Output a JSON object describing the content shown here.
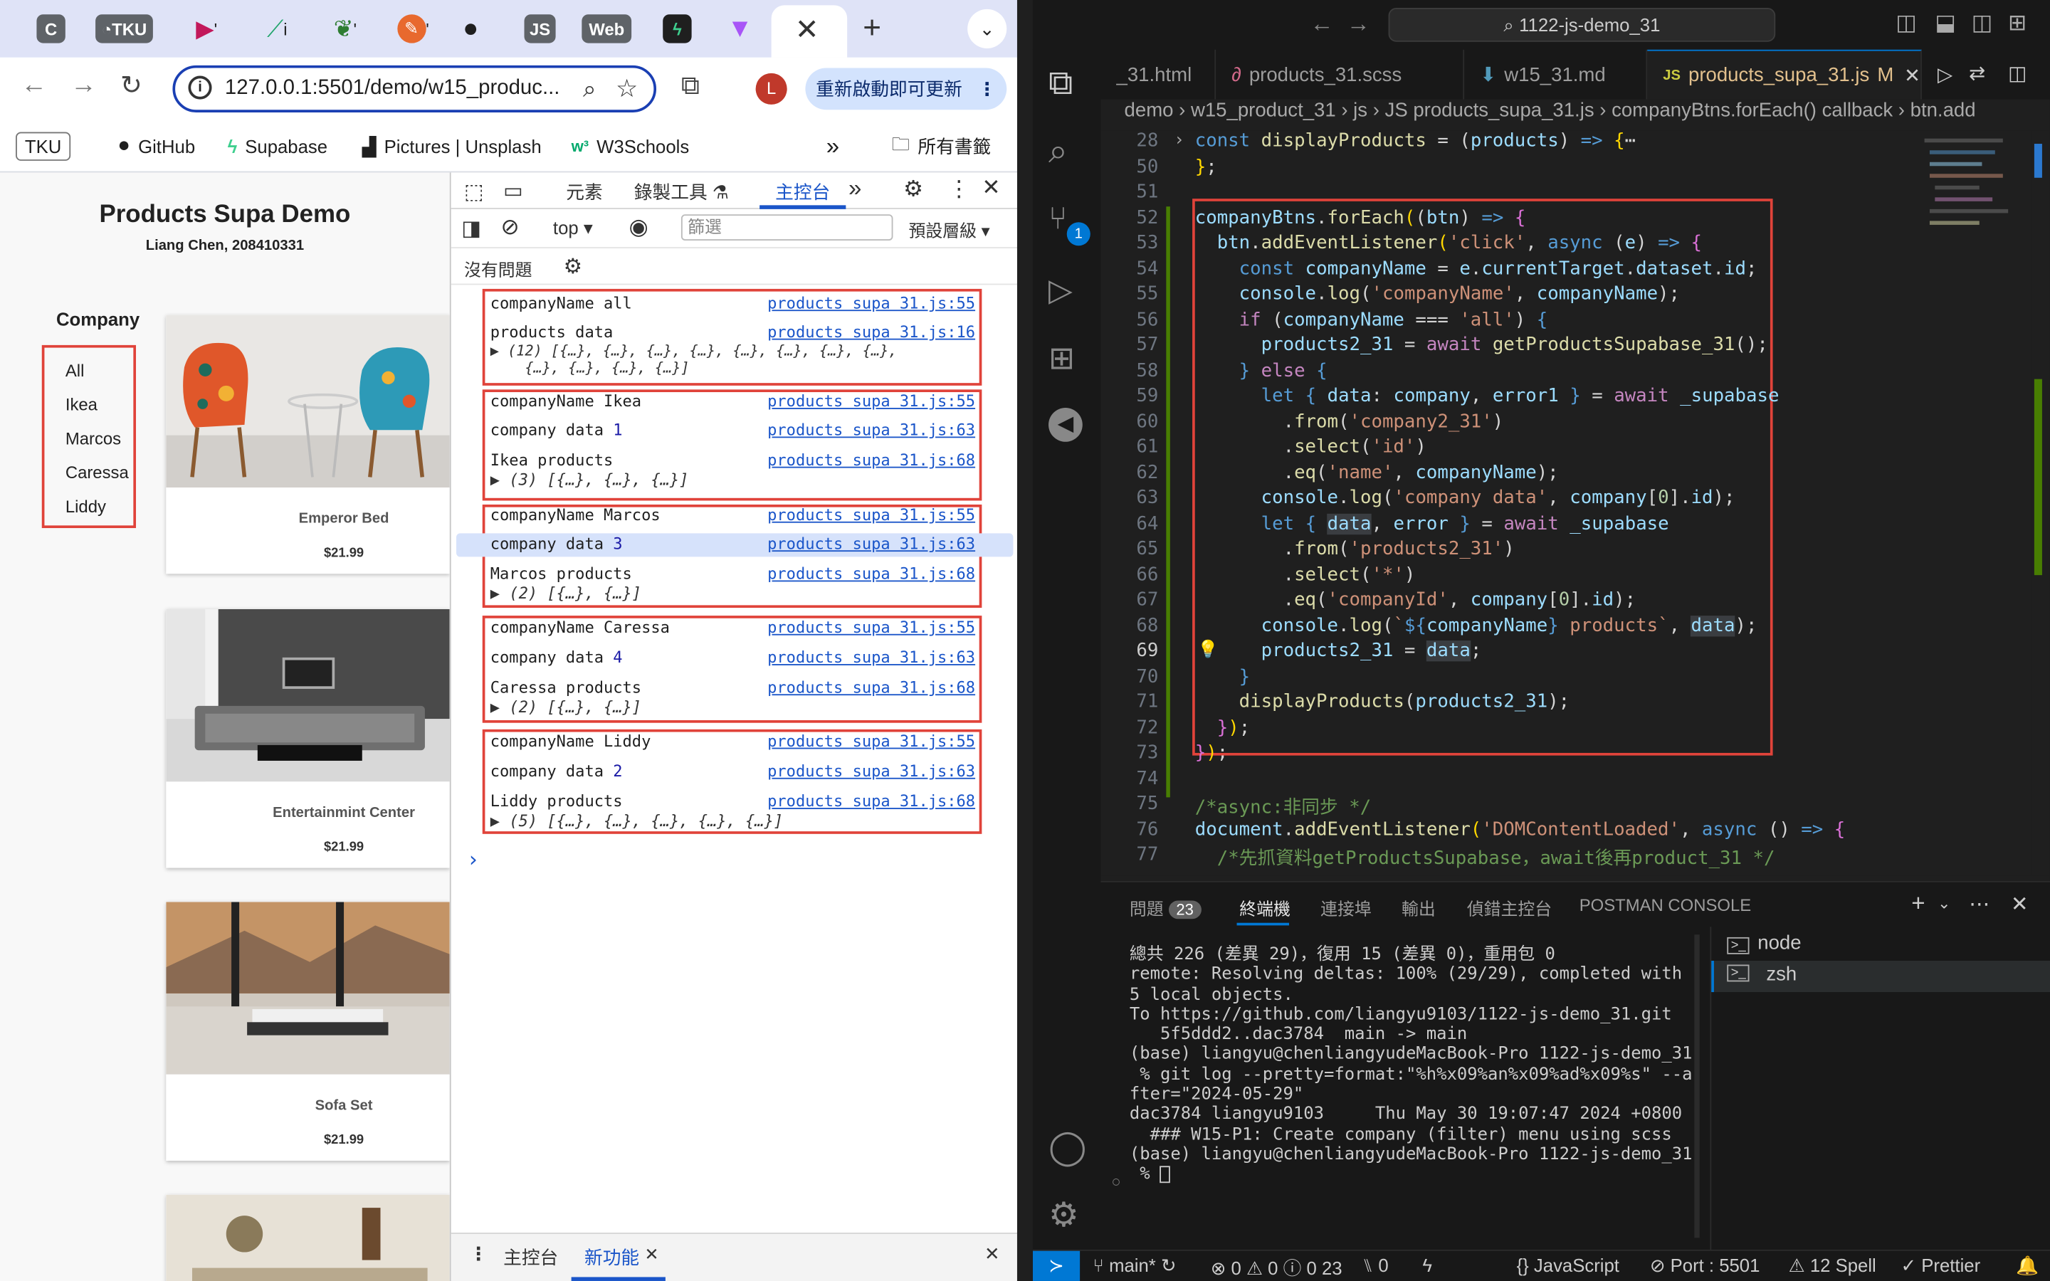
{
  "browser": {
    "tabs": [
      {
        "label": "C",
        "color": "#5f6368"
      },
      {
        "label": "TKU",
        "color": "#5f6368"
      },
      {
        "label": "'",
        "color": "#c2185b"
      },
      {
        "label": "i",
        "color": "#20a46b"
      },
      {
        "label": "'",
        "color": "#2e7d32"
      },
      {
        "label": "'",
        "color": "#e8692e"
      },
      {
        "label": "",
        "color": "#1f1f1f"
      },
      {
        "label": "JS",
        "color": "#5f6368"
      },
      {
        "label": "Web",
        "color": "#5f6368"
      },
      {
        "label": "",
        "color": "#2e7d32"
      },
      {
        "label": "",
        "color": "#ffc83d"
      }
    ],
    "new_tab": "+",
    "address": "127.0.0.1:5501/demo/w15_produc...",
    "update_button": "重新啟動即可更新",
    "avatar": "L",
    "bookmarks": [
      "TKU",
      "GitHub",
      "Supabase",
      "Pictures | Unsplash",
      "W3Schools"
    ],
    "bookmarks_more": "»",
    "all_bookmarks": "所有書籤"
  },
  "page": {
    "title": "Products Supa Demo",
    "subtitle": "Liang Chen, 208410331",
    "company_label": "Company",
    "companies": [
      "All",
      "Ikea",
      "Marcos",
      "Caressa",
      "Liddy"
    ],
    "products": [
      {
        "name": "Emperor Bed",
        "price": "$21.99"
      },
      {
        "name": "Entertainmint Center",
        "price": "$21.99"
      },
      {
        "name": "Sofa Set",
        "price": "$21.99"
      }
    ]
  },
  "devtools": {
    "tabs": [
      "元素",
      "錄製工具 ⚗",
      "主控台"
    ],
    "context": "top",
    "filter_placeholder": "篩選",
    "levels": "預設層級 ▾",
    "no_issues": "沒有問題",
    "console": [
      {
        "text": "companyName all",
        "link": "products supa 31.js:55"
      },
      {
        "text": "products data",
        "link": "products supa 31.js:16",
        "sub": "▶ (12) [{…}, {…}, {…}, {…}, {…}, {…}, {…}, {…},",
        "sub2": "    {…}, {…}, {…}, {…}]"
      },
      {
        "text": "companyName Ikea",
        "link": "products supa 31.js:55"
      },
      {
        "text": "company data ",
        "num": "1",
        "link": "products supa 31.js:63"
      },
      {
        "text": "Ikea products",
        "link": "products supa 31.js:68",
        "sub": "▶ (3) [{…}, {…}, {…}]"
      },
      {
        "text": "companyName Marcos",
        "link": "products supa 31.js:55"
      },
      {
        "text": "company data ",
        "num": "3",
        "link": "products supa 31.js:63"
      },
      {
        "text": "Marcos products",
        "link": "products supa 31.js:68",
        "sub": "▶ (2) [{…}, {…}]"
      },
      {
        "text": "companyName Caressa",
        "link": "products supa 31.js:55"
      },
      {
        "text": "company data ",
        "num": "4",
        "link": "products supa 31.js:63"
      },
      {
        "text": "Caressa products",
        "link": "products supa 31.js:68",
        "sub": "▶ (2) [{…}, {…}]"
      },
      {
        "text": "companyName Liddy",
        "link": "products supa 31.js:55"
      },
      {
        "text": "company data ",
        "num": "2",
        "link": "products supa 31.js:63"
      },
      {
        "text": "Liddy products",
        "link": "products supa 31.js:68",
        "sub": "▶ (5) [{…}, {…}, {…}, {…}, {…}]"
      }
    ],
    "prompt": "›",
    "drawer_tabs": [
      "主控台",
      "新功能"
    ]
  },
  "vscode": {
    "search": "1122-js-demo_31",
    "tabs": [
      {
        "label": "_31.html"
      },
      {
        "label": "products_31.scss"
      },
      {
        "label": "w15_31.md"
      },
      {
        "label": "products_supa_31.js",
        "badge": "M"
      }
    ],
    "breadcrumb": "demo › w15_product_31 › js › JS products_supa_31.js › companyBtns.forEach() callback › btn.add",
    "line_numbers": [
      "28",
      "50",
      "51",
      "52",
      "53",
      "54",
      "55",
      "56",
      "57",
      "58",
      "59",
      "60",
      "61",
      "62",
      "63",
      "64",
      "65",
      "66",
      "67",
      "68",
      "69",
      "70",
      "71",
      "72",
      "73",
      "74",
      "75",
      "76",
      "77"
    ],
    "scm_badge": "1",
    "panel_tabs": [
      "問題",
      "終端機",
      "連接埠",
      "輸出",
      "偵錯主控台",
      "POSTMAN CONSOLE"
    ],
    "problems_count": "23",
    "terminal_lines": [
      "總共 226 (差異 29)，復用 15 (差異 0)，重用包 0",
      "remote: Resolving deltas: 100% (29/29), completed with",
      "5 local objects.",
      "To https://github.com/liangyu9103/1122-js-demo_31.git",
      "   5f5ddd2..dac3784  main -> main",
      "(base) liangyu@chenliangyudeMacBook-Pro 1122-js-demo_31",
      " % git log --pretty=format:\"%h%x09%an%x09%ad%x09%s\" --a",
      "fter=\"2024-05-29\"",
      "dac3784 liangyu9103     Thu May 30 19:07:47 2024 +0800",
      "  ### W15-P1: Create company (filter) menu using scss",
      "(base) liangyu@chenliangyudeMacBook-Pro 1122-js-demo_31",
      " % "
    ],
    "terminals": [
      "node",
      "zsh"
    ],
    "status": {
      "branch": "main*",
      "errors": "0",
      "warnings": "0",
      "info": "0",
      "infos2": "23",
      "ports": "0",
      "language": "JavaScript",
      "port": "Port : 5501",
      "spell": "12 Spell",
      "prettier": "Prettier"
    }
  }
}
